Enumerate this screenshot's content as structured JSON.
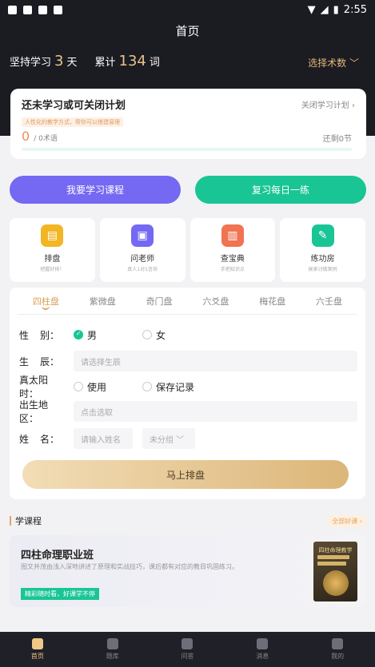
{
  "status_bar": {
    "time": "2:55"
  },
  "header": {
    "title": "首页"
  },
  "stats": {
    "streak_prefix": "坚持学习",
    "streak_value": "3",
    "streak_unit": "天",
    "total_prefix": "累计",
    "total_value": "134",
    "total_unit": "词",
    "select_label": "选择术数 ﹀"
  },
  "plan": {
    "title": "还未学习或可关闭计划",
    "close_label": "关闭学习计划 ›",
    "tip": "人性化的教学方式，帮你可以搭建易理",
    "progress_value": "0",
    "progress_unit": "/ 0术语",
    "days_left": "还剩0节"
  },
  "actions": {
    "course_label": "我要学习课程",
    "review_label": "复习每日一练"
  },
  "tools": [
    {
      "label": "排盘",
      "sub": "把握好排！",
      "color": "#f2b524",
      "glyph": "▤"
    },
    {
      "label": "问老师",
      "sub": "真人1对1咨询",
      "color": "#7568f2",
      "glyph": "▣"
    },
    {
      "label": "查宝典",
      "sub": "手把知识点",
      "color": "#f07352",
      "glyph": "▥"
    },
    {
      "label": "练功房",
      "sub": "挨家讨做案例",
      "color": "#19c595",
      "glyph": "✎"
    }
  ],
  "chart_tabs": [
    "四柱盘",
    "紫微盘",
    "奇门盘",
    "六爻盘",
    "梅花盘",
    "六壬盘"
  ],
  "form": {
    "gender_label_a": "性",
    "gender_label_b": "别：",
    "male": "男",
    "female": "女",
    "birth_label_a": "生",
    "birth_label_b": "辰：",
    "birth_placeholder": "请选择生辰",
    "solar_label": "真太阳时：",
    "solar_use": "使用",
    "save_record": "保存记录",
    "region_label": "出生地区：",
    "region_placeholder": "点击选取",
    "name_label_a": "姓",
    "name_label_b": "名：",
    "name_placeholder": "请输入姓名",
    "group_select": "未分组 ﹀",
    "submit": "马上排盘"
  },
  "courses": {
    "section_title": "学课程",
    "more": "全部好课 ›",
    "card_title": "四柱命理职业班",
    "card_desc": "图文并茂由浅入深地讲述了原理和实战技巧，课后都有对应的教目巩固练习。",
    "card_tag": "精彩随时看，好课学不停",
    "book_title": "四柱命理教学"
  },
  "bottom_nav": [
    {
      "label": "首页",
      "active": true
    },
    {
      "label": "题库",
      "active": false
    },
    {
      "label": "问答",
      "active": false
    },
    {
      "label": "消息",
      "active": false
    },
    {
      "label": "我的",
      "active": false
    }
  ]
}
